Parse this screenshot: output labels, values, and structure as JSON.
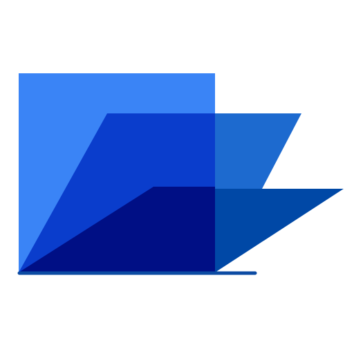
{
  "icon": {
    "name": "open-folder-layers-icon",
    "colors": {
      "back_panel": "#3A84F6",
      "middle_panel": "#0A3DCC",
      "middle_panel_overhang": "#1D6ACF",
      "front_panel": "#000F85",
      "front_panel_overhang": "#0048A6",
      "base_line": "#0C4BA3",
      "background": "#FFFFFF"
    }
  }
}
